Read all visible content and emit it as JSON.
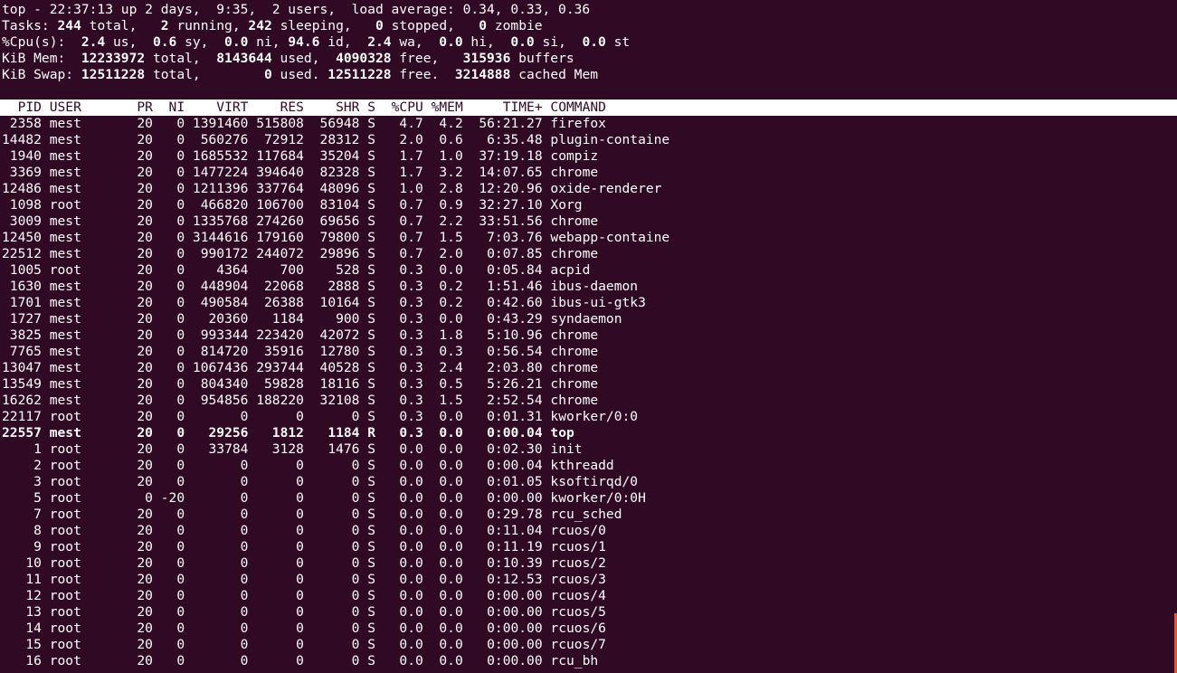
{
  "summary": {
    "l1": "top - 22:37:13 up 2 days,  9:35,  2 users,  load average: 0.34, 0.33, 0.36",
    "l2": {
      "a": "Tasks: ",
      "total": "244",
      "b": " total,   ",
      "running": "2",
      "c": " running, ",
      "sleeping": "242",
      "d": " sleeping,   ",
      "stopped": "0",
      "e": " stopped,   ",
      "zombie": "0",
      "f": " zombie"
    },
    "l3": {
      "a": "%Cpu(s):  ",
      "us": "2.4",
      "b": " us,  ",
      "sy": "0.6",
      "c": " sy,  ",
      "ni": "0.0",
      "d": " ni, ",
      "id": "94.6",
      "e": " id,  ",
      "wa": "2.4",
      "f": " wa,  ",
      "hi": "0.0",
      "g": " hi,  ",
      "si": "0.0",
      "h": " si,  ",
      "st": "0.0",
      "i": " st"
    },
    "l4": {
      "a": "KiB Mem:  ",
      "total": "12233972",
      "b": " total,  ",
      "used": "8143644",
      "c": " used,  ",
      "free": "4090328",
      "d": " free,   ",
      "buffers": "315936",
      "e": " buffers"
    },
    "l5": {
      "a": "KiB Swap: ",
      "total": "12511228",
      "b": " total,        ",
      "used": "0",
      "c": " used. ",
      "free": "12511228",
      "d": " free.  ",
      "cached": "3214888",
      "e": " cached Mem"
    }
  },
  "columns": [
    "PID",
    "USER",
    "PR",
    "NI",
    "VIRT",
    "RES",
    "SHR",
    "S",
    "%CPU",
    "%MEM",
    "TIME+",
    "COMMAND"
  ],
  "processes": [
    [
      "2358",
      "mest",
      "20",
      "0",
      "1391460",
      "515808",
      "56948",
      "S",
      "4.7",
      "4.2",
      "56:21.27",
      "firefox"
    ],
    [
      "14482",
      "mest",
      "20",
      "0",
      "560276",
      "72912",
      "28312",
      "S",
      "2.0",
      "0.6",
      "6:35.48",
      "plugin-containe"
    ],
    [
      "1940",
      "mest",
      "20",
      "0",
      "1685532",
      "117684",
      "35204",
      "S",
      "1.7",
      "1.0",
      "37:19.18",
      "compiz"
    ],
    [
      "3369",
      "mest",
      "20",
      "0",
      "1477224",
      "394640",
      "82328",
      "S",
      "1.7",
      "3.2",
      "14:07.65",
      "chrome"
    ],
    [
      "12486",
      "mest",
      "20",
      "0",
      "1211396",
      "337764",
      "48096",
      "S",
      "1.0",
      "2.8",
      "12:20.96",
      "oxide-renderer"
    ],
    [
      "1098",
      "root",
      "20",
      "0",
      "466820",
      "106700",
      "83104",
      "S",
      "0.7",
      "0.9",
      "32:27.10",
      "Xorg"
    ],
    [
      "3009",
      "mest",
      "20",
      "0",
      "1335768",
      "274260",
      "69656",
      "S",
      "0.7",
      "2.2",
      "33:51.56",
      "chrome"
    ],
    [
      "12450",
      "mest",
      "20",
      "0",
      "3144616",
      "179160",
      "79800",
      "S",
      "0.7",
      "1.5",
      "7:03.76",
      "webapp-containe"
    ],
    [
      "22512",
      "mest",
      "20",
      "0",
      "990172",
      "244072",
      "29896",
      "S",
      "0.7",
      "2.0",
      "0:07.85",
      "chrome"
    ],
    [
      "1005",
      "root",
      "20",
      "0",
      "4364",
      "700",
      "528",
      "S",
      "0.3",
      "0.0",
      "0:05.84",
      "acpid"
    ],
    [
      "1630",
      "mest",
      "20",
      "0",
      "448904",
      "22068",
      "2888",
      "S",
      "0.3",
      "0.2",
      "1:51.46",
      "ibus-daemon"
    ],
    [
      "1701",
      "mest",
      "20",
      "0",
      "490584",
      "26388",
      "10164",
      "S",
      "0.3",
      "0.2",
      "0:42.60",
      "ibus-ui-gtk3"
    ],
    [
      "1727",
      "mest",
      "20",
      "0",
      "20360",
      "1184",
      "900",
      "S",
      "0.3",
      "0.0",
      "0:43.29",
      "syndaemon"
    ],
    [
      "3825",
      "mest",
      "20",
      "0",
      "993344",
      "223420",
      "42072",
      "S",
      "0.3",
      "1.8",
      "5:10.96",
      "chrome"
    ],
    [
      "7765",
      "mest",
      "20",
      "0",
      "814720",
      "35916",
      "12780",
      "S",
      "0.3",
      "0.3",
      "0:56.54",
      "chrome"
    ],
    [
      "13047",
      "mest",
      "20",
      "0",
      "1067436",
      "293744",
      "40528",
      "S",
      "0.3",
      "2.4",
      "2:03.80",
      "chrome"
    ],
    [
      "13549",
      "mest",
      "20",
      "0",
      "804340",
      "59828",
      "18116",
      "S",
      "0.3",
      "0.5",
      "5:26.21",
      "chrome"
    ],
    [
      "16262",
      "mest",
      "20",
      "0",
      "954856",
      "188220",
      "32108",
      "S",
      "0.3",
      "1.5",
      "2:52.54",
      "chrome"
    ],
    [
      "22117",
      "root",
      "20",
      "0",
      "0",
      "0",
      "0",
      "S",
      "0.3",
      "0.0",
      "0:01.31",
      "kworker/0:0"
    ],
    [
      "22557",
      "mest",
      "20",
      "0",
      "29256",
      "1812",
      "1184",
      "R",
      "0.3",
      "0.0",
      "0:00.04",
      "top"
    ],
    [
      "1",
      "root",
      "20",
      "0",
      "33784",
      "3128",
      "1476",
      "S",
      "0.0",
      "0.0",
      "0:02.30",
      "init"
    ],
    [
      "2",
      "root",
      "20",
      "0",
      "0",
      "0",
      "0",
      "S",
      "0.0",
      "0.0",
      "0:00.04",
      "kthreadd"
    ],
    [
      "3",
      "root",
      "20",
      "0",
      "0",
      "0",
      "0",
      "S",
      "0.0",
      "0.0",
      "0:01.05",
      "ksoftirqd/0"
    ],
    [
      "5",
      "root",
      "0",
      "-20",
      "0",
      "0",
      "0",
      "S",
      "0.0",
      "0.0",
      "0:00.00",
      "kworker/0:0H"
    ],
    [
      "7",
      "root",
      "20",
      "0",
      "0",
      "0",
      "0",
      "S",
      "0.0",
      "0.0",
      "0:29.78",
      "rcu_sched"
    ],
    [
      "8",
      "root",
      "20",
      "0",
      "0",
      "0",
      "0",
      "S",
      "0.0",
      "0.0",
      "0:11.04",
      "rcuos/0"
    ],
    [
      "9",
      "root",
      "20",
      "0",
      "0",
      "0",
      "0",
      "S",
      "0.0",
      "0.0",
      "0:11.19",
      "rcuos/1"
    ],
    [
      "10",
      "root",
      "20",
      "0",
      "0",
      "0",
      "0",
      "S",
      "0.0",
      "0.0",
      "0:10.39",
      "rcuos/2"
    ],
    [
      "11",
      "root",
      "20",
      "0",
      "0",
      "0",
      "0",
      "S",
      "0.0",
      "0.0",
      "0:12.53",
      "rcuos/3"
    ],
    [
      "12",
      "root",
      "20",
      "0",
      "0",
      "0",
      "0",
      "S",
      "0.0",
      "0.0",
      "0:00.00",
      "rcuos/4"
    ],
    [
      "13",
      "root",
      "20",
      "0",
      "0",
      "0",
      "0",
      "S",
      "0.0",
      "0.0",
      "0:00.00",
      "rcuos/5"
    ],
    [
      "14",
      "root",
      "20",
      "0",
      "0",
      "0",
      "0",
      "S",
      "0.0",
      "0.0",
      "0:00.00",
      "rcuos/6"
    ],
    [
      "15",
      "root",
      "20",
      "0",
      "0",
      "0",
      "0",
      "S",
      "0.0",
      "0.0",
      "0:00.00",
      "rcuos/7"
    ],
    [
      "16",
      "root",
      "20",
      "0",
      "0",
      "0",
      "0",
      "S",
      "0.0",
      "0.0",
      "0:00.00",
      "rcu_bh"
    ]
  ],
  "highlight_pid": "22557",
  "colors": {
    "background": "#300a24",
    "foreground": "#ffffff",
    "header_bg": "#ffffff",
    "cursor": "#e95420"
  }
}
